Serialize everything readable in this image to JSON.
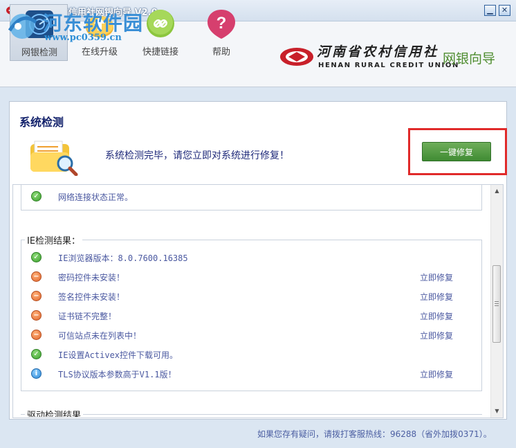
{
  "window": {
    "title": "河南省农村信用社网银向导 V2.0"
  },
  "watermark": {
    "brand": "河东软件园",
    "url": "www.pc0359.cn"
  },
  "toolbar": {
    "tools": [
      {
        "label": "网银检测"
      },
      {
        "label": "在线升级"
      },
      {
        "label": "快捷链接"
      },
      {
        "label": "帮助"
      }
    ]
  },
  "brand": {
    "name_cn": "河南省农村信用社",
    "name_en": "HENAN RURAL CREDIT UNION",
    "product": "网银向导"
  },
  "main": {
    "section_title": "系统检测",
    "status_message": "系统检测完毕，请您立即对系统进行修复！",
    "fix_all_label": "一键修复"
  },
  "results": {
    "network_row": {
      "status": "ok",
      "text": "网络连接状态正常。"
    },
    "ie_group_label": "IE检测结果：",
    "ie_rows": [
      {
        "status": "ok",
        "text": "IE浏览器版本：8.0.7600.16385",
        "action": ""
      },
      {
        "status": "warn",
        "text": "密码控件未安装！",
        "action": "立即修复"
      },
      {
        "status": "warn",
        "text": "签名控件未安装！",
        "action": "立即修复"
      },
      {
        "status": "warn",
        "text": "证书链不完整！",
        "action": "立即修复"
      },
      {
        "status": "warn",
        "text": "可信站点未在列表中！",
        "action": "立即修复"
      },
      {
        "status": "ok",
        "text": "IE设置Activex控件下载可用。",
        "action": ""
      },
      {
        "status": "info",
        "text": "TLS协议版本参数高于V1.1版！",
        "action": "立即修复"
      }
    ],
    "driver_group_label": "驱动检测结果"
  },
  "footer": {
    "hotline": "如果您存有疑问，请拨打客服热线：96288（省外加拨0371）。"
  },
  "colors": {
    "accent_green": "#4a9a3c",
    "highlight_red": "#e02a2a",
    "title_navy": "#12216b"
  }
}
